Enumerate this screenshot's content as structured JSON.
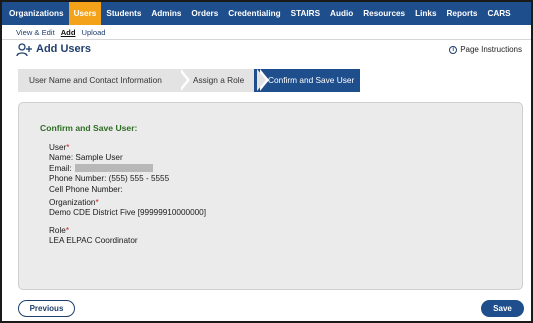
{
  "topnav": {
    "items": [
      {
        "label": "Organizations"
      },
      {
        "label": "Users"
      },
      {
        "label": "Students"
      },
      {
        "label": "Admins"
      },
      {
        "label": "Orders"
      },
      {
        "label": "Credentialing"
      },
      {
        "label": "STAIRS"
      },
      {
        "label": "Audio"
      },
      {
        "label": "Resources"
      },
      {
        "label": "Links"
      },
      {
        "label": "Reports"
      },
      {
        "label": "CARS"
      }
    ],
    "active": "Users",
    "color": "#1f4e8c",
    "active_color": "#f5a21b"
  },
  "subnav": {
    "items": [
      {
        "label": "View & Edit"
      },
      {
        "label": "Add"
      },
      {
        "label": "Upload"
      }
    ],
    "active": "Add"
  },
  "header": {
    "title": "Add Users",
    "icon": "add-user-icon",
    "instructions_label": "Page Instructions",
    "instructions_icon": "info-icon"
  },
  "steps": [
    {
      "label": "User Name and Contact Information",
      "state": "done"
    },
    {
      "label": "Assign a Role",
      "state": "done"
    },
    {
      "label": "Confirm and Save User",
      "state": "current"
    }
  ],
  "panel": {
    "heading": "Confirm and Save User:",
    "user_section": {
      "label": "User",
      "required_mark": "*",
      "name_line": "Name: Sample User",
      "email_label": "Email:",
      "phone_line": "Phone Number: (555) 555 - 5555",
      "cell_line": "Cell Phone Number:"
    },
    "org_section": {
      "label": "Organization",
      "required_mark": "*",
      "value": "Demo CDE District Five [99999910000000]"
    },
    "role_section": {
      "label": "Role",
      "required_mark": "*",
      "value": "LEA ELPAC Coordinator"
    }
  },
  "buttons": {
    "previous": "Previous",
    "save": "Save"
  }
}
